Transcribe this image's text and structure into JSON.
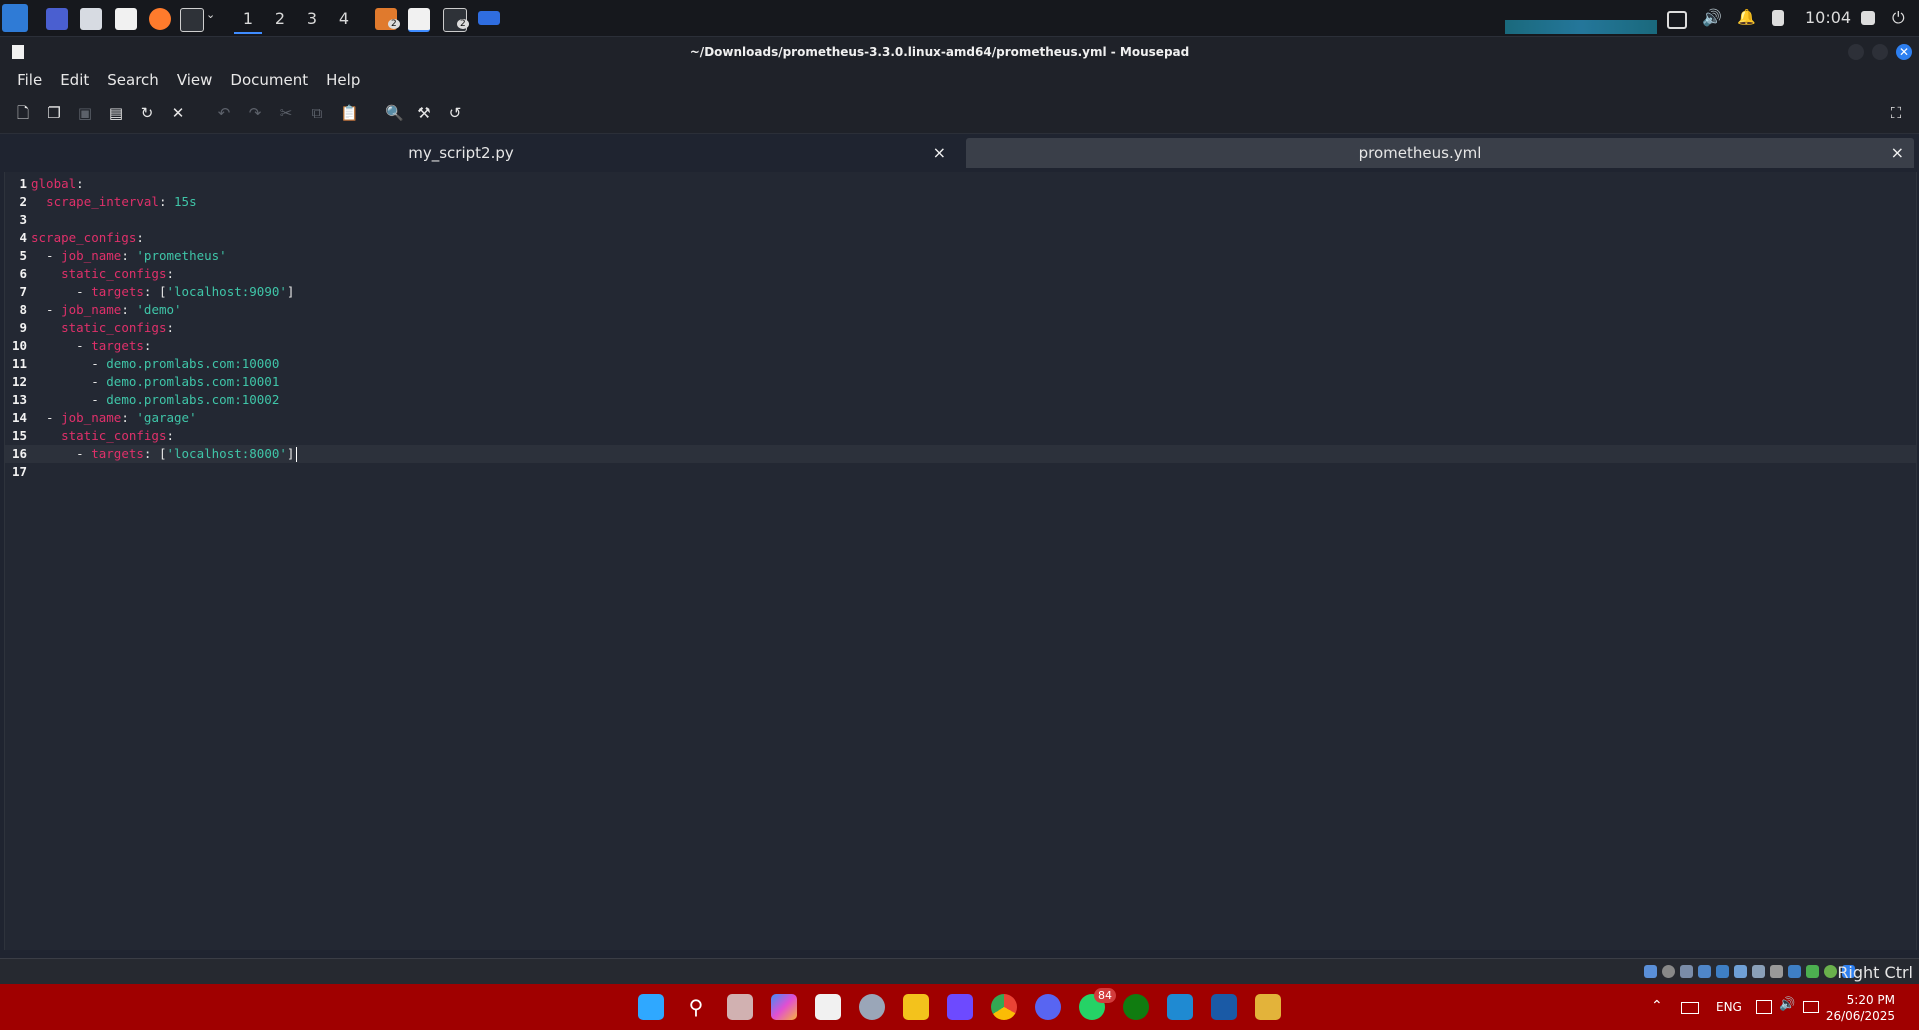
{
  "top_panel": {
    "workspaces": [
      "1",
      "2",
      "3",
      "4"
    ],
    "active_workspace": "1",
    "badges": [
      "2",
      "2"
    ],
    "clock": "10:04",
    "icons": [
      "kali-menu-icon",
      "desktop-icon",
      "file-manager-icon",
      "text-editor-icon",
      "firefox-icon",
      "terminal-icon",
      "chevron-down-icon",
      "cpu-graph-icon",
      "display-icon",
      "volume-icon",
      "bell-icon",
      "battery-icon",
      "lock-icon",
      "logout-icon"
    ]
  },
  "window": {
    "title": "~/Downloads/prometheus-3.3.0.linux-amd64/prometheus.yml - Mousepad"
  },
  "menu": [
    "File",
    "Edit",
    "Search",
    "View",
    "Document",
    "Help"
  ],
  "toolbar": {
    "icons": [
      "new-document-icon",
      "new-window-icon",
      "save-icon",
      "save-as-icon",
      "reload-icon",
      "close-icon",
      "undo-icon",
      "redo-icon",
      "cut-icon",
      "copy-icon",
      "paste-icon",
      "search-icon",
      "find-replace-icon",
      "goto-icon",
      "fullscreen-icon"
    ]
  },
  "tabs": [
    {
      "label": "my_script2.py",
      "close": "×",
      "active": false
    },
    {
      "label": "prometheus.yml",
      "close": "×",
      "active": true
    }
  ],
  "editor": {
    "current_line": 16,
    "lines": [
      {
        "n": "1",
        "tokens": [
          [
            "k",
            "global"
          ],
          [
            "p",
            ":"
          ]
        ]
      },
      {
        "n": "2",
        "tokens": [
          [
            "p",
            "  "
          ],
          [
            "k",
            "scrape_interval"
          ],
          [
            "p",
            ": "
          ],
          [
            "s",
            "15s"
          ]
        ]
      },
      {
        "n": "3",
        "tokens": []
      },
      {
        "n": "4",
        "tokens": [
          [
            "k",
            "scrape_configs"
          ],
          [
            "p",
            ":"
          ]
        ]
      },
      {
        "n": "5",
        "tokens": [
          [
            "p",
            "  - "
          ],
          [
            "k",
            "job_name"
          ],
          [
            "p",
            ": "
          ],
          [
            "s",
            "'prometheus'"
          ]
        ]
      },
      {
        "n": "6",
        "tokens": [
          [
            "p",
            "    "
          ],
          [
            "k",
            "static_configs"
          ],
          [
            "p",
            ":"
          ]
        ]
      },
      {
        "n": "7",
        "tokens": [
          [
            "p",
            "      - "
          ],
          [
            "k",
            "targets"
          ],
          [
            "p",
            ": ["
          ],
          [
            "s",
            "'localhost:9090'"
          ],
          [
            "p",
            "]"
          ]
        ]
      },
      {
        "n": "8",
        "tokens": [
          [
            "p",
            "  - "
          ],
          [
            "k",
            "job_name"
          ],
          [
            "p",
            ": "
          ],
          [
            "s",
            "'demo'"
          ]
        ]
      },
      {
        "n": "9",
        "tokens": [
          [
            "p",
            "    "
          ],
          [
            "k",
            "static_configs"
          ],
          [
            "p",
            ":"
          ]
        ]
      },
      {
        "n": "10",
        "tokens": [
          [
            "p",
            "      - "
          ],
          [
            "k",
            "targets"
          ],
          [
            "p",
            ":"
          ]
        ]
      },
      {
        "n": "11",
        "tokens": [
          [
            "p",
            "        - "
          ],
          [
            "s",
            "demo.promlabs.com:10000"
          ]
        ]
      },
      {
        "n": "12",
        "tokens": [
          [
            "p",
            "        - "
          ],
          [
            "s",
            "demo.promlabs.com:10001"
          ]
        ]
      },
      {
        "n": "13",
        "tokens": [
          [
            "p",
            "        - "
          ],
          [
            "s",
            "demo.promlabs.com:10002"
          ]
        ]
      },
      {
        "n": "14",
        "tokens": [
          [
            "p",
            "  - "
          ],
          [
            "k",
            "job_name"
          ],
          [
            "p",
            ": "
          ],
          [
            "s",
            "'garage'"
          ]
        ]
      },
      {
        "n": "15",
        "tokens": [
          [
            "p",
            "    "
          ],
          [
            "k",
            "static_configs"
          ],
          [
            "p",
            ":"
          ]
        ]
      },
      {
        "n": "16",
        "tokens": [
          [
            "p",
            "      - "
          ],
          [
            "k",
            "targets"
          ],
          [
            "p",
            ": ["
          ],
          [
            "s",
            "'localhost:8000'"
          ],
          [
            "p",
            "]"
          ]
        ]
      },
      {
        "n": "17",
        "tokens": []
      }
    ]
  },
  "vm_status": {
    "host_key": "Right Ctrl"
  },
  "taskbar": {
    "whatsapp_badge": "84",
    "language": "ENG",
    "time": "5:20 PM",
    "date": "26/06/2025",
    "icons": [
      "windows-start-icon",
      "search-icon",
      "task-view-icon",
      "copilot-icon",
      "store-icon",
      "settings-icon",
      "file-explorer-icon",
      "proton-icon",
      "chrome-icon",
      "discord-icon",
      "whatsapp-icon",
      "xbox-icon",
      "vscode-icon",
      "virtualbox-icon",
      "kali-vm-icon"
    ]
  },
  "colors": {
    "keyword": "#e0306a",
    "string": "#3fc5a8",
    "taskbar": "#a00000",
    "accent": "#3f8cff"
  }
}
